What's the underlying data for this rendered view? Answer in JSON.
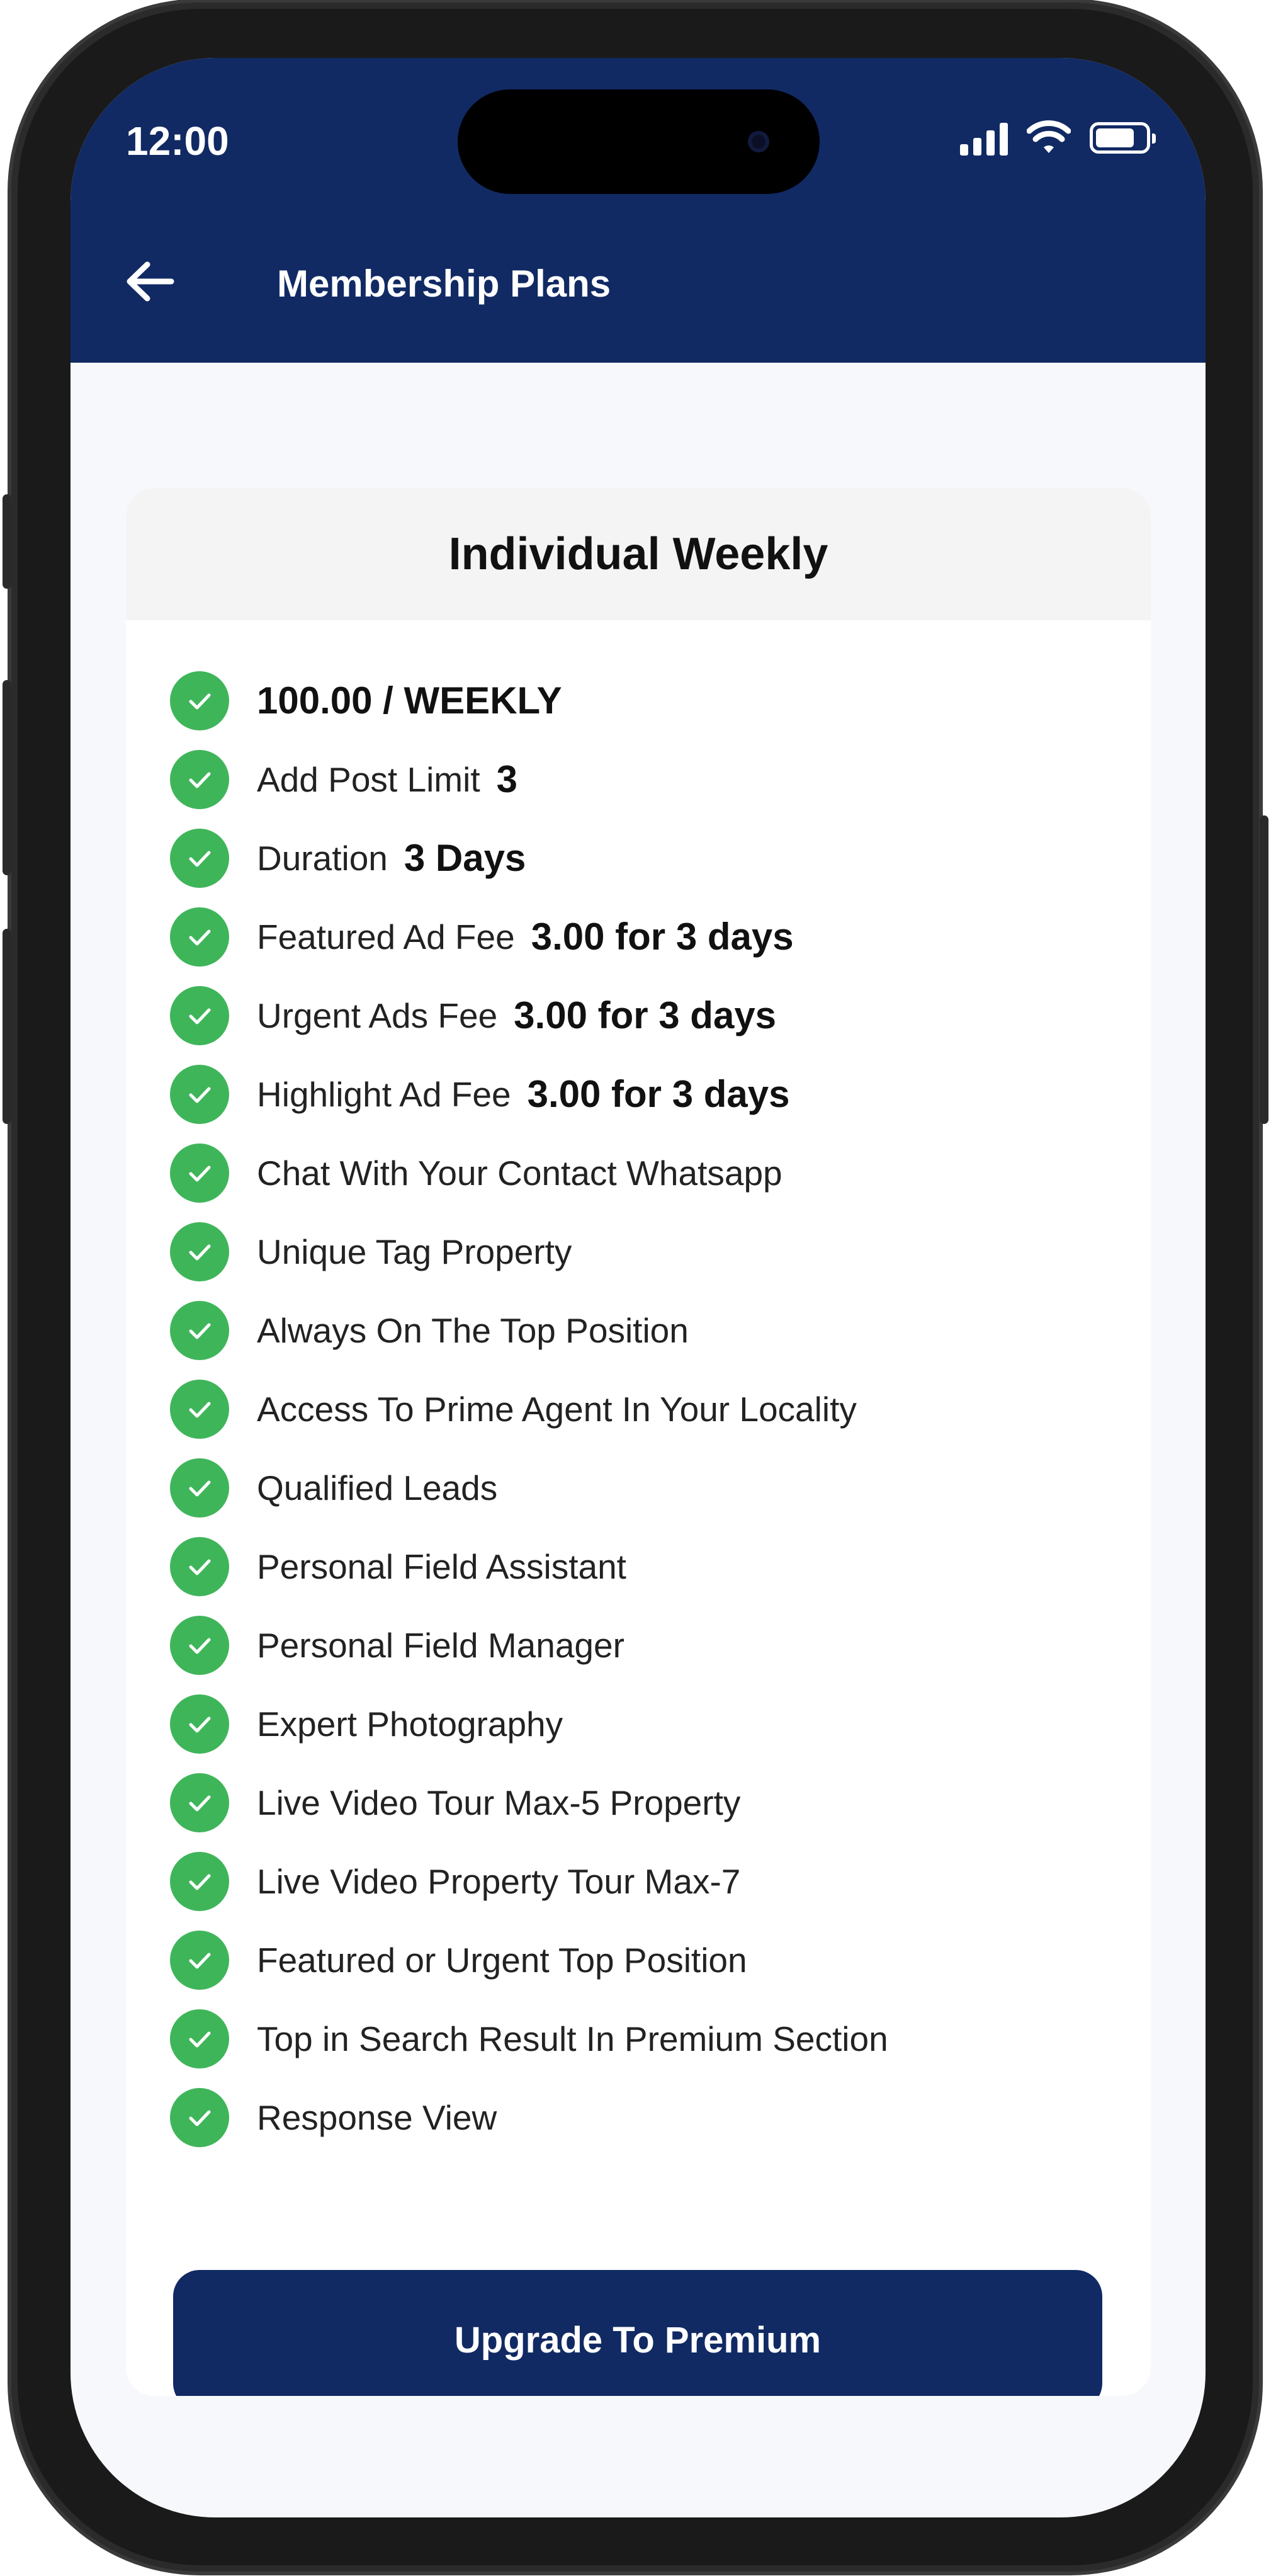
{
  "status_bar": {
    "time": "12:00"
  },
  "header": {
    "title": "Membership Plans"
  },
  "plan": {
    "name": "Individual Weekly",
    "price": "100.00 / WEEKLY",
    "post_limit_label": "Add Post Limit",
    "post_limit_value": "3",
    "duration_label": "Duration",
    "duration_value": "3 Days",
    "featured_label": "Featured Ad Fee",
    "featured_value": "3.00 for 3 days",
    "urgent_label": "Urgent Ads Fee",
    "urgent_value": "3.00 for 3 days",
    "highlight_label": "Highlight Ad Fee",
    "highlight_value": "3.00 for 3 days",
    "features": [
      "Chat With Your Contact Whatsapp",
      "Unique Tag Property",
      "Always On The Top Position",
      "Access To Prime Agent In Your Locality",
      "Qualified Leads",
      "Personal Field Assistant",
      "Personal Field Manager",
      "Expert Photography",
      "Live Video Tour Max-5 Property",
      "Live Video Property Tour Max-7",
      "Featured or Urgent Top Position",
      "Top in Search Result In Premium Section",
      "Response View"
    ]
  },
  "actions": {
    "upgrade_label": "Upgrade To Premium"
  },
  "colors": {
    "header_bg": "#112a64",
    "check": "#3fb55a",
    "button_bg": "#112a64"
  },
  "icons": [
    "back-arrow-icon",
    "check-icon",
    "signal-icon",
    "wifi-icon",
    "battery-icon"
  ]
}
